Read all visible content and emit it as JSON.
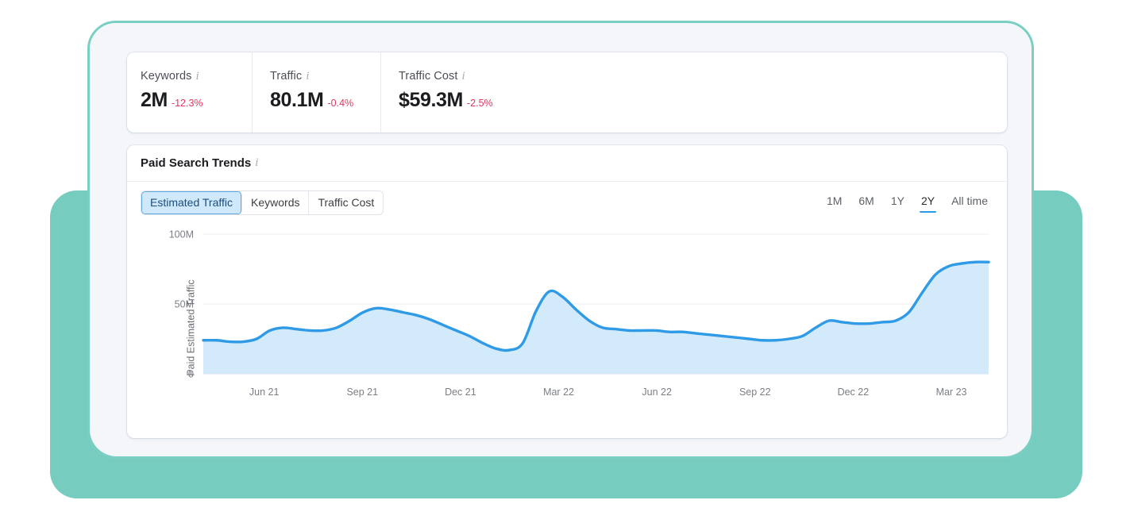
{
  "metrics": [
    {
      "label": "Keywords",
      "info_icon": "info-icon",
      "value": "2M",
      "delta": "-12.3%"
    },
    {
      "label": "Traffic",
      "info_icon": "info-icon",
      "value": "80.1M",
      "delta": "-0.4%"
    },
    {
      "label": "Traffic Cost",
      "info_icon": "info-icon",
      "value": "$59.3M",
      "delta": "-2.5%"
    }
  ],
  "chart_card": {
    "title": "Paid Search Trends",
    "info_icon": "info-icon",
    "metric_tabs": [
      {
        "label": "Estimated Traffic",
        "active": true
      },
      {
        "label": "Keywords",
        "active": false
      },
      {
        "label": "Traffic Cost",
        "active": false
      }
    ],
    "ranges": [
      {
        "label": "1M",
        "active": false
      },
      {
        "label": "6M",
        "active": false
      },
      {
        "label": "1Y",
        "active": false
      },
      {
        "label": "2Y",
        "active": true
      },
      {
        "label": "All time",
        "active": false
      }
    ]
  },
  "colors": {
    "accent_blue": "#2f9ae5",
    "area_fill": "#d3eafb",
    "teal": "#75ccbf",
    "panel": "#f4f6fa",
    "negative": "#e5355f"
  },
  "chart_data": {
    "type": "area",
    "title": "Paid Search Trends",
    "xlabel": "",
    "ylabel": "Paid Estimated Traffic",
    "ylim": [
      0,
      100
    ],
    "unit": "M",
    "grid": true,
    "legend": false,
    "ytick_labels": [
      "100M",
      "50M",
      "0"
    ],
    "ytick_values": [
      100,
      50,
      0
    ],
    "xtick_labels": [
      "Jun 21",
      "Sep 21",
      "Dec 21",
      "Mar 22",
      "Jun 22",
      "Sep 22",
      "Dec 22",
      "Mar 23"
    ],
    "series": [
      {
        "name": "Paid Estimated Traffic",
        "values": [
          24,
          24,
          23,
          23,
          25,
          31,
          33,
          32,
          31,
          31,
          33,
          38,
          44,
          47,
          46,
          44,
          42,
          39,
          35,
          31,
          27,
          22,
          18,
          17,
          22,
          45,
          59,
          55,
          46,
          38,
          33,
          32,
          31,
          31,
          31,
          30,
          30,
          29,
          28,
          27,
          26,
          25,
          24,
          24,
          25,
          27,
          33,
          38,
          37,
          36,
          36,
          37,
          38,
          44,
          58,
          71,
          77,
          79,
          80,
          80
        ]
      }
    ]
  }
}
